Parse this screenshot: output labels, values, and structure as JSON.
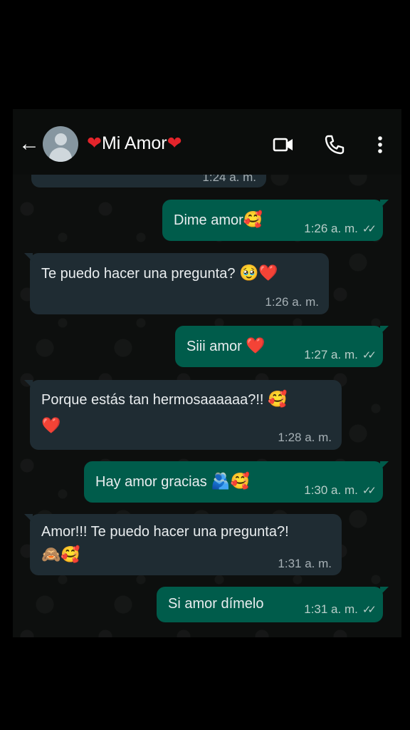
{
  "header": {
    "contact_name": "Mi Amor",
    "heart_left": "❤",
    "heart_right": "❤",
    "back_icon": "arrow-left",
    "video_icon": "video-camera",
    "call_icon": "phone",
    "menu_icon": "more-vertical"
  },
  "colors": {
    "incoming_bubble": "#1f2c33",
    "outgoing_bubble": "#005c4b",
    "background": "#0b0d0c"
  },
  "messages": [
    {
      "dir": "in",
      "text": "",
      "time": "1:24 a. m."
    },
    {
      "dir": "out",
      "text": "Dime amor",
      "emoji": "🥰",
      "time": "1:26 a. m.",
      "read": true
    },
    {
      "dir": "in",
      "text": "Te puedo hacer una pregunta?",
      "emoji": "🥹❤️",
      "time": "1:26 a. m."
    },
    {
      "dir": "out",
      "text": "Siii amor",
      "emoji": "❤️",
      "time": "1:27 a. m.",
      "read": true
    },
    {
      "dir": "in",
      "text": "Porque estás tan hermosaaaaaa?!!",
      "emoji": "🥰",
      "emoji2": "❤️",
      "time": "1:28 a. m."
    },
    {
      "dir": "out",
      "text": "Hay amor gracias",
      "emoji": "🫂🥰",
      "time": "1:30 a. m.",
      "read": true
    },
    {
      "dir": "in",
      "text": "Amor!!! Te puedo hacer una pregunta?!",
      "emoji2": "🙈🥰",
      "time": "1:31 a. m."
    },
    {
      "dir": "out",
      "text": "Si amor dímelo",
      "time": "1:31 a. m.",
      "read": true
    }
  ]
}
